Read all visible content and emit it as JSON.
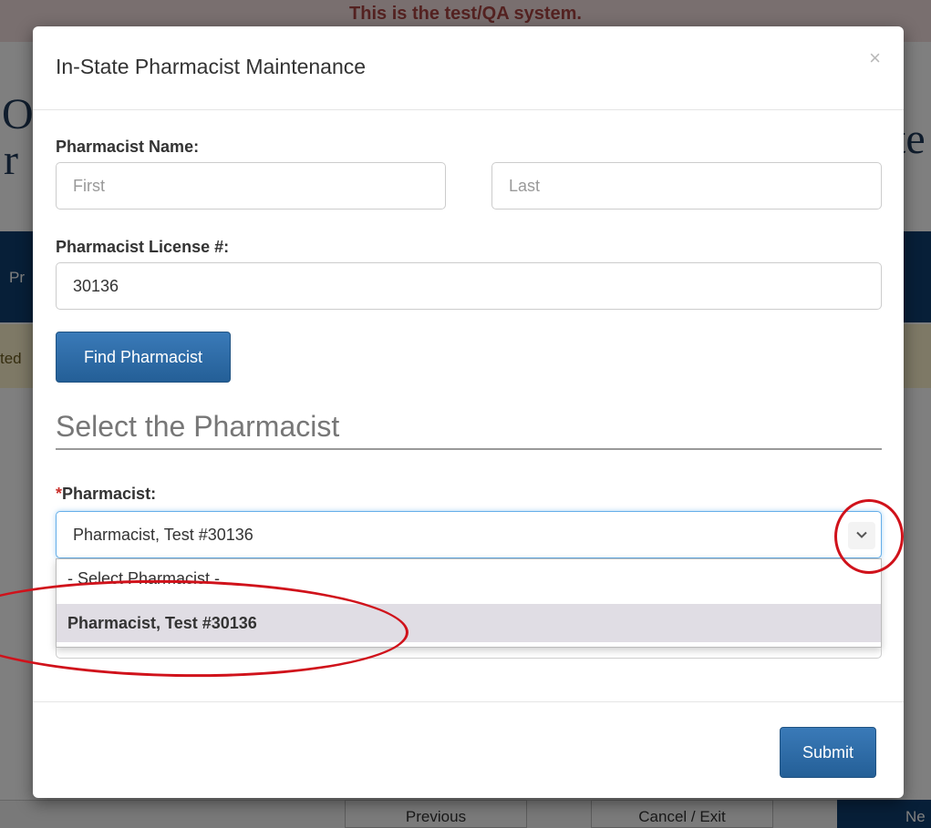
{
  "background": {
    "banner_text": "This is the test/QA system.",
    "heading_fragment_left": "O",
    "heading_fragment_left2": "r",
    "heading_fragment_right": "te",
    "nav_fragment": "Pr",
    "warn_fragment": "ted",
    "footer_buttons": [
      "Previous",
      "Cancel / Exit",
      "Ne"
    ]
  },
  "modal": {
    "title": "In-State Pharmacist Maintenance",
    "close_glyph": "×",
    "name_label": "Pharmacist Name:",
    "first_placeholder": "First",
    "last_placeholder": "Last",
    "license_label": "Pharmacist License #:",
    "license_value": "30136",
    "find_button": "Find Pharmacist",
    "section_title": "Select the Pharmacist",
    "required_marker": "*",
    "pharmacist_label": "Pharmacist:",
    "selected_value": "Pharmacist, Test #30136",
    "options": [
      "- Select Pharmacist -",
      "Pharmacist, Test #30136"
    ],
    "submit_button": "Submit"
  },
  "colors": {
    "primary_button": "#2c6aa6",
    "annotation": "#d0121b",
    "focus_border": "#66afe9"
  },
  "icons": {
    "close": "close-icon",
    "dropdown": "chevron-down-icon"
  }
}
